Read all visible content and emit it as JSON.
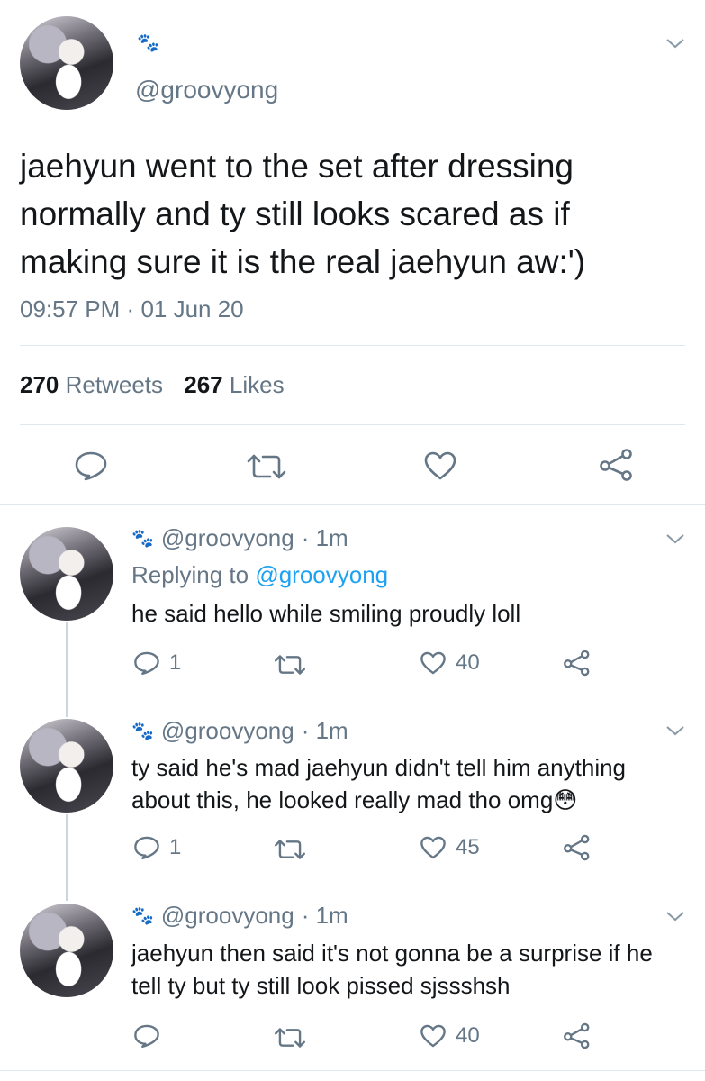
{
  "main_tweet": {
    "handle": "@groovyong",
    "text": "jaehyun went to the set after dressing normally and ty still looks scared as if making sure it is the real jaehyun aw:')",
    "time": "09:57 PM",
    "sep": "·",
    "date": "01 Jun 20",
    "retweets_count": "270",
    "retweets_label": "Retweets",
    "likes_count": "267",
    "likes_label": "Likes"
  },
  "replies": [
    {
      "handle": "@groovyong",
      "meta": "· 1m",
      "replying_prefix": "Replying to",
      "replying_to": "@groovyong",
      "text": "he said hello while smiling proudly loll",
      "reply_count": "1",
      "like_count": "40"
    },
    {
      "handle": "@groovyong",
      "meta": "· 1m",
      "text": "ty said he's mad jaehyun didn't tell him anything about this, he looked really mad tho omg😳",
      "reply_count": "1",
      "like_count": "45"
    },
    {
      "handle": "@groovyong",
      "meta": "· 1m",
      "text": "jaehyun then said it's not gonna be a surprise if he tell ty but ty still look pissed sjssshsh",
      "reply_count": "",
      "like_count": "40"
    }
  ],
  "icons": {
    "paw": "🐾",
    "chevron": "chevron-down-icon",
    "reply": "reply-icon",
    "retweet": "retweet-icon",
    "like": "heart-icon",
    "share": "share-icon"
  },
  "colors": {
    "link": "#1da1f2",
    "secondary_text": "#657786",
    "divider": "#e1e8ed",
    "thread_line": "#ccd6dd"
  }
}
